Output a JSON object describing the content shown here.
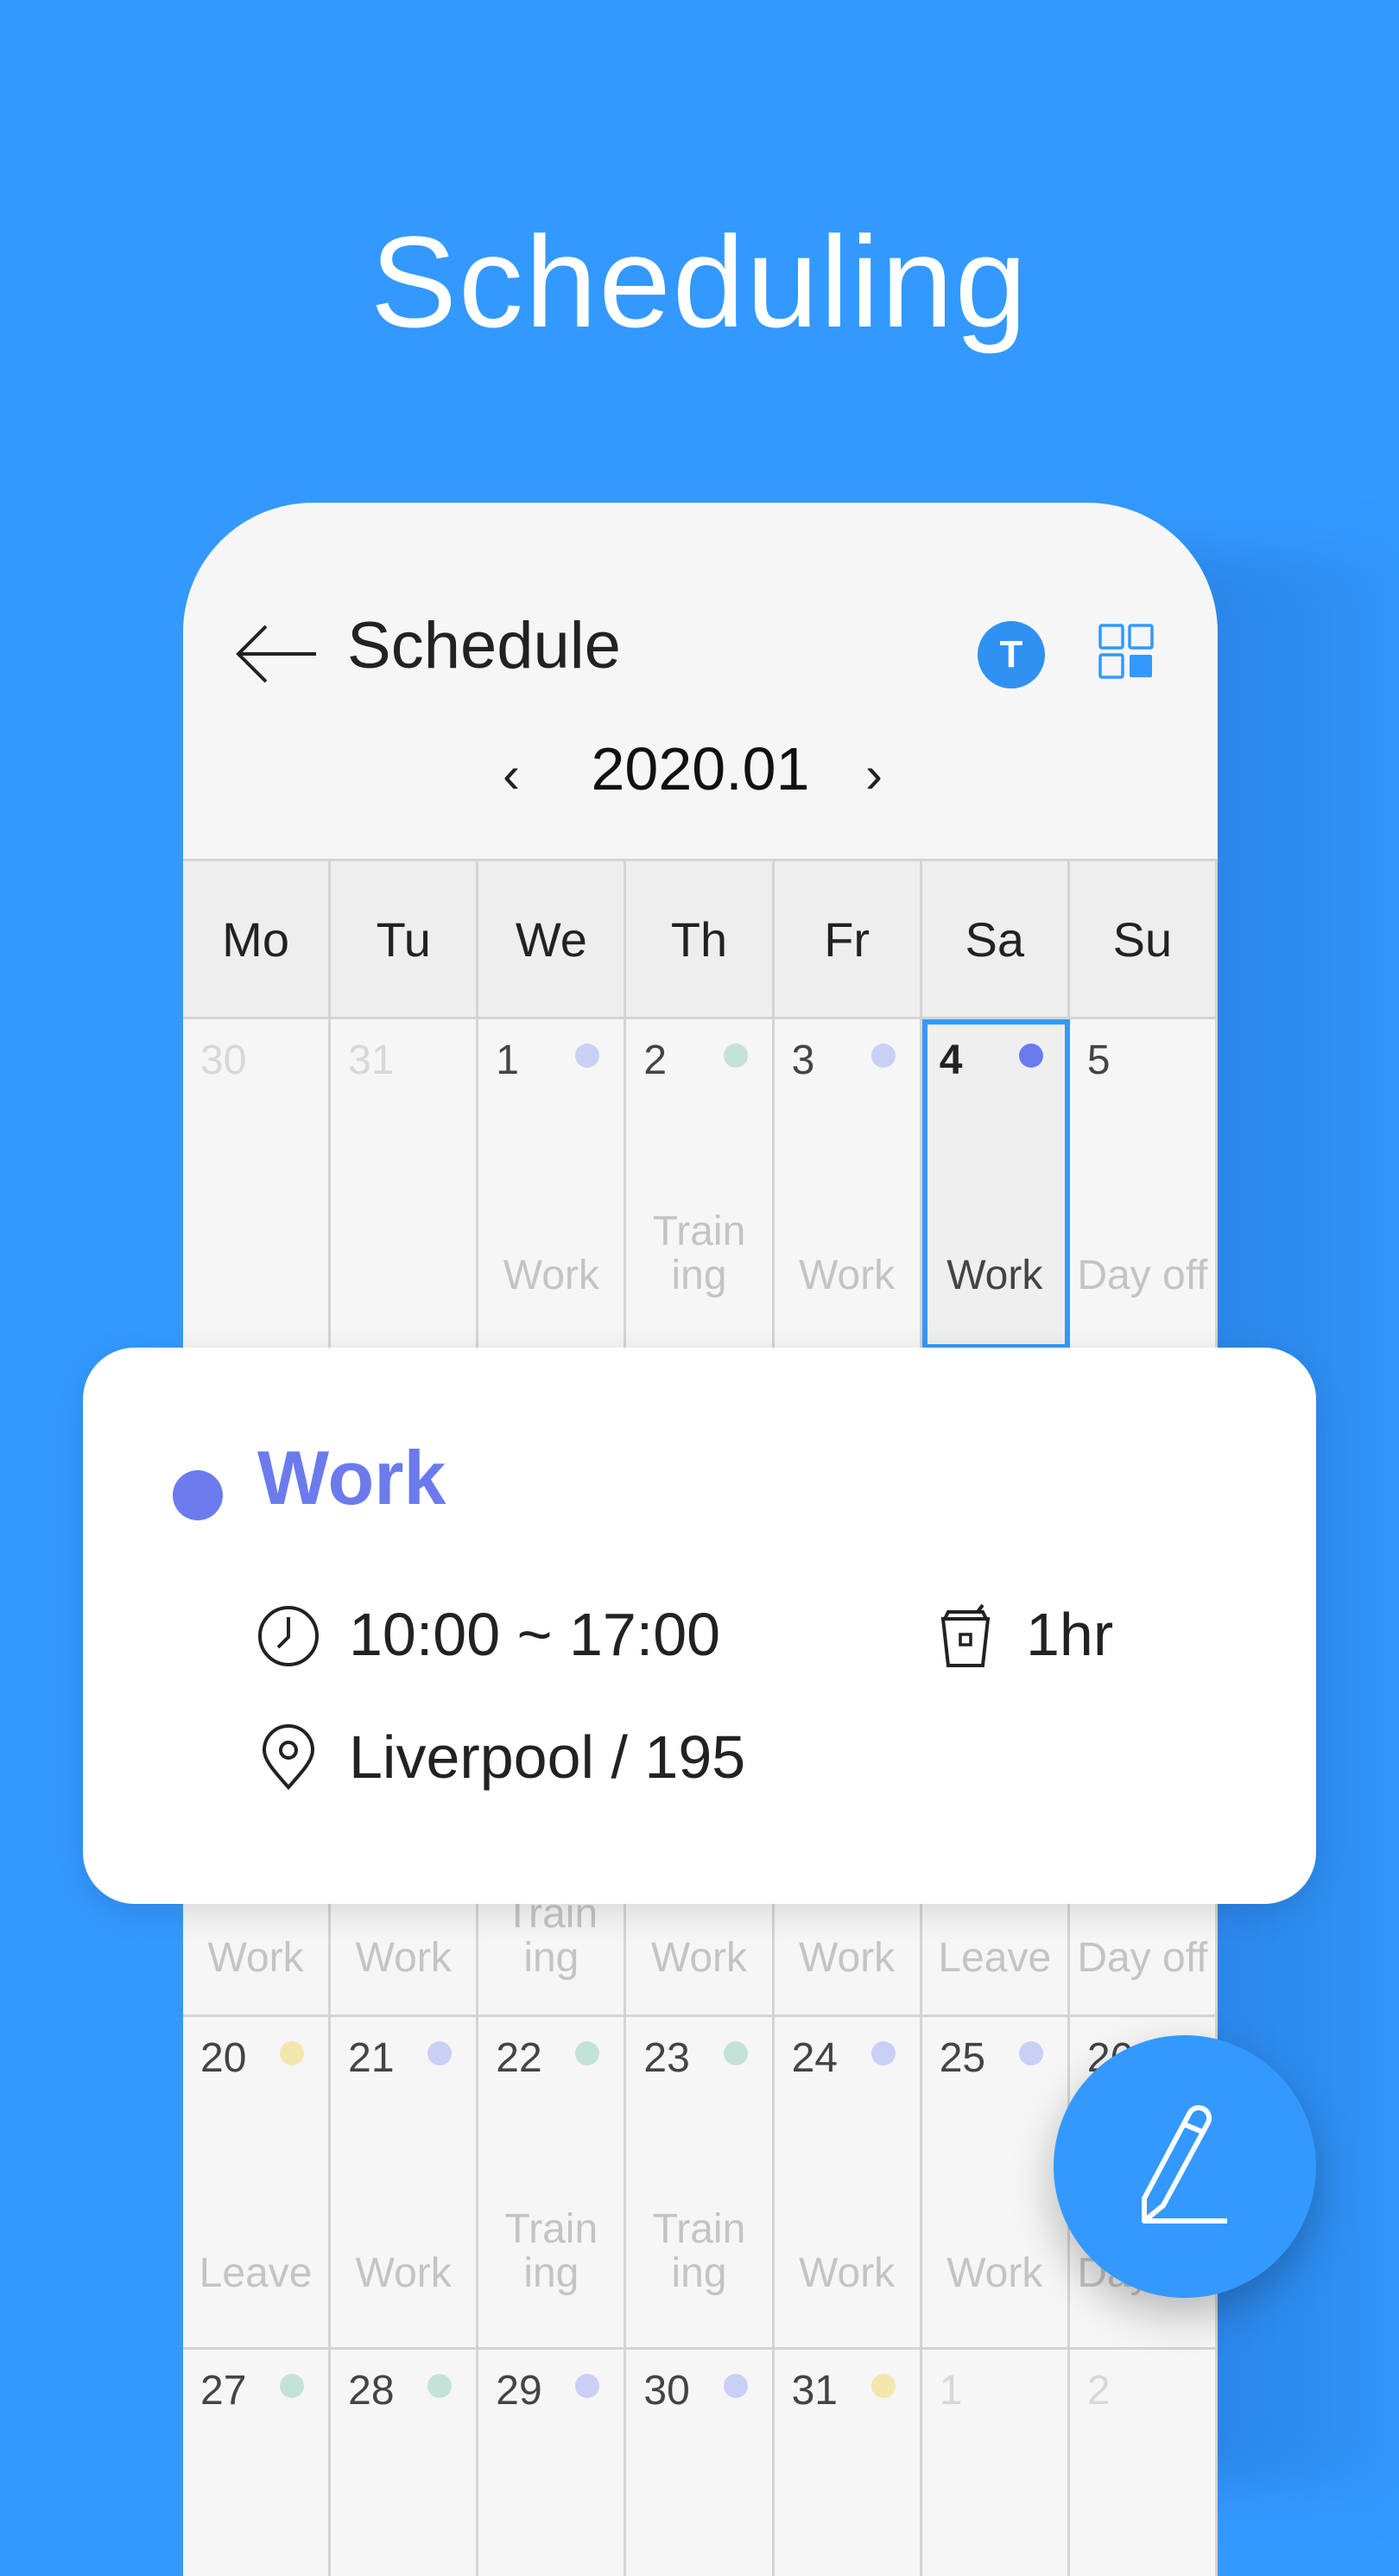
{
  "headline": "Scheduling",
  "header": {
    "title": "Schedule",
    "avatar_letter": "T",
    "month": "2020.01"
  },
  "colors": {
    "background": "#3399FF",
    "work": "#6B7BEE",
    "work_light": "#CACFF5",
    "training": "#C5E2D8",
    "leave": "#F3E7AE"
  },
  "weekdays": [
    "Mo",
    "Tu",
    "We",
    "Th",
    "Fr",
    "Sa",
    "Su"
  ],
  "week1": [
    {
      "num": "30",
      "out": true,
      "dot": "",
      "label": ""
    },
    {
      "num": "31",
      "out": true,
      "dot": "",
      "label": ""
    },
    {
      "num": "1",
      "dot": "#CACFF5",
      "label": "Work"
    },
    {
      "num": "2",
      "dot": "#C5E2D8",
      "label": "Train\ning"
    },
    {
      "num": "3",
      "dot": "#CACFF5",
      "label": "Work"
    },
    {
      "num": "4",
      "dot": "#6B7BEE",
      "label": "Work",
      "selected": true
    },
    {
      "num": "5",
      "dot": "",
      "label": "Day off"
    }
  ],
  "week3_labels": [
    "Work",
    "Work",
    "Train\ning",
    "Work",
    "Work",
    "Leave",
    "Day off"
  ],
  "week4": [
    {
      "num": "20",
      "dot": "#F3E7AE",
      "label": "Leave"
    },
    {
      "num": "21",
      "dot": "#CACFF5",
      "label": "Work"
    },
    {
      "num": "22",
      "dot": "#C5E2D8",
      "label": "Train\ning"
    },
    {
      "num": "23",
      "dot": "#C5E2D8",
      "label": "Train\ning"
    },
    {
      "num": "24",
      "dot": "#CACFF5",
      "label": "Work"
    },
    {
      "num": "25",
      "dot": "#CACFF5",
      "label": "Work"
    },
    {
      "num": "26",
      "dot": "",
      "label": "Day off"
    }
  ],
  "week5": [
    {
      "num": "27",
      "dot": "#C5E2D8",
      "label": ""
    },
    {
      "num": "28",
      "dot": "#C5E2D8",
      "label": ""
    },
    {
      "num": "29",
      "dot": "#CACFF5",
      "label": ""
    },
    {
      "num": "30",
      "dot": "#CACFF5",
      "label": ""
    },
    {
      "num": "31",
      "dot": "#F3E7AE",
      "label": ""
    },
    {
      "num": "1",
      "out": true,
      "dot": "",
      "label": ""
    },
    {
      "num": "2",
      "out": true,
      "dot": "",
      "label": ""
    }
  ],
  "detail": {
    "title": "Work",
    "time": "10:00 ~ 17:00",
    "break": "1hr",
    "location": "Liverpool / 195"
  }
}
